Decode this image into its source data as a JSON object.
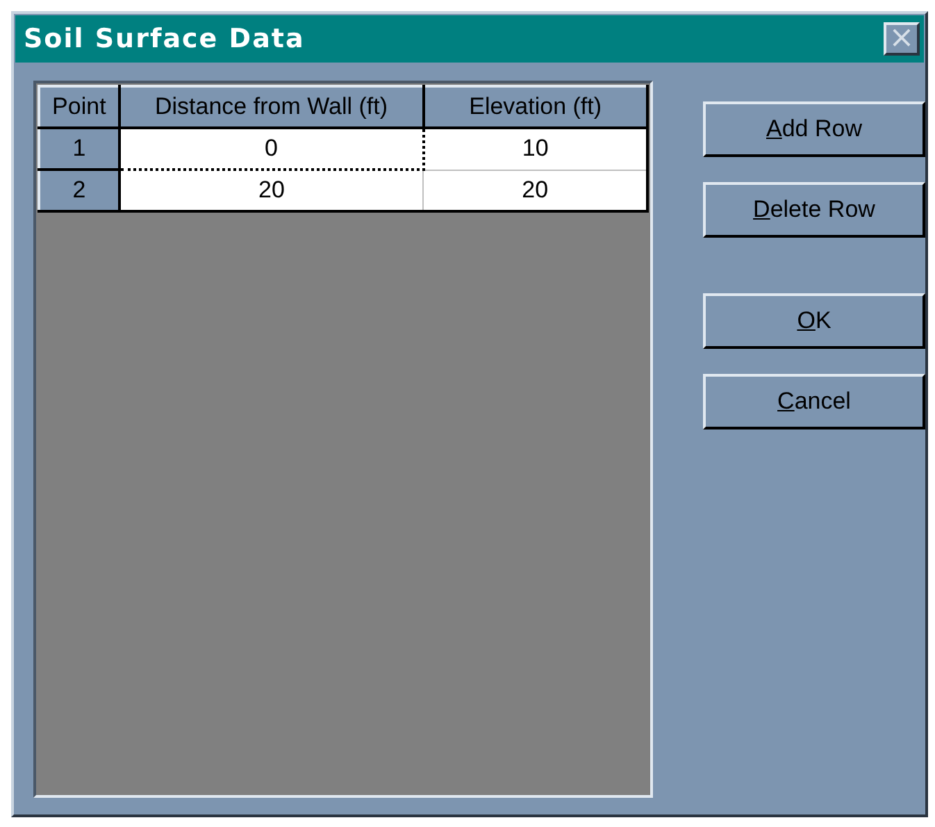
{
  "window": {
    "title": "Soil Surface Data",
    "close_glyph": "×"
  },
  "table": {
    "columns": [
      "Point",
      "Distance from Wall (ft)",
      "Elevation (ft)"
    ],
    "rows": [
      {
        "cells": [
          {
            "text": "1",
            "focused": false
          },
          {
            "text": "0",
            "focused": true
          },
          {
            "text": "10",
            "focused": false
          }
        ]
      },
      {
        "cells": [
          {
            "text": "2",
            "focused": false
          },
          {
            "text": "20",
            "focused": false
          },
          {
            "text": "20",
            "focused": false
          }
        ]
      }
    ]
  },
  "row_buttons": [
    "Add Row",
    "Delete Row"
  ],
  "dialog_buttons": [
    "OK",
    "Cancel"
  ]
}
